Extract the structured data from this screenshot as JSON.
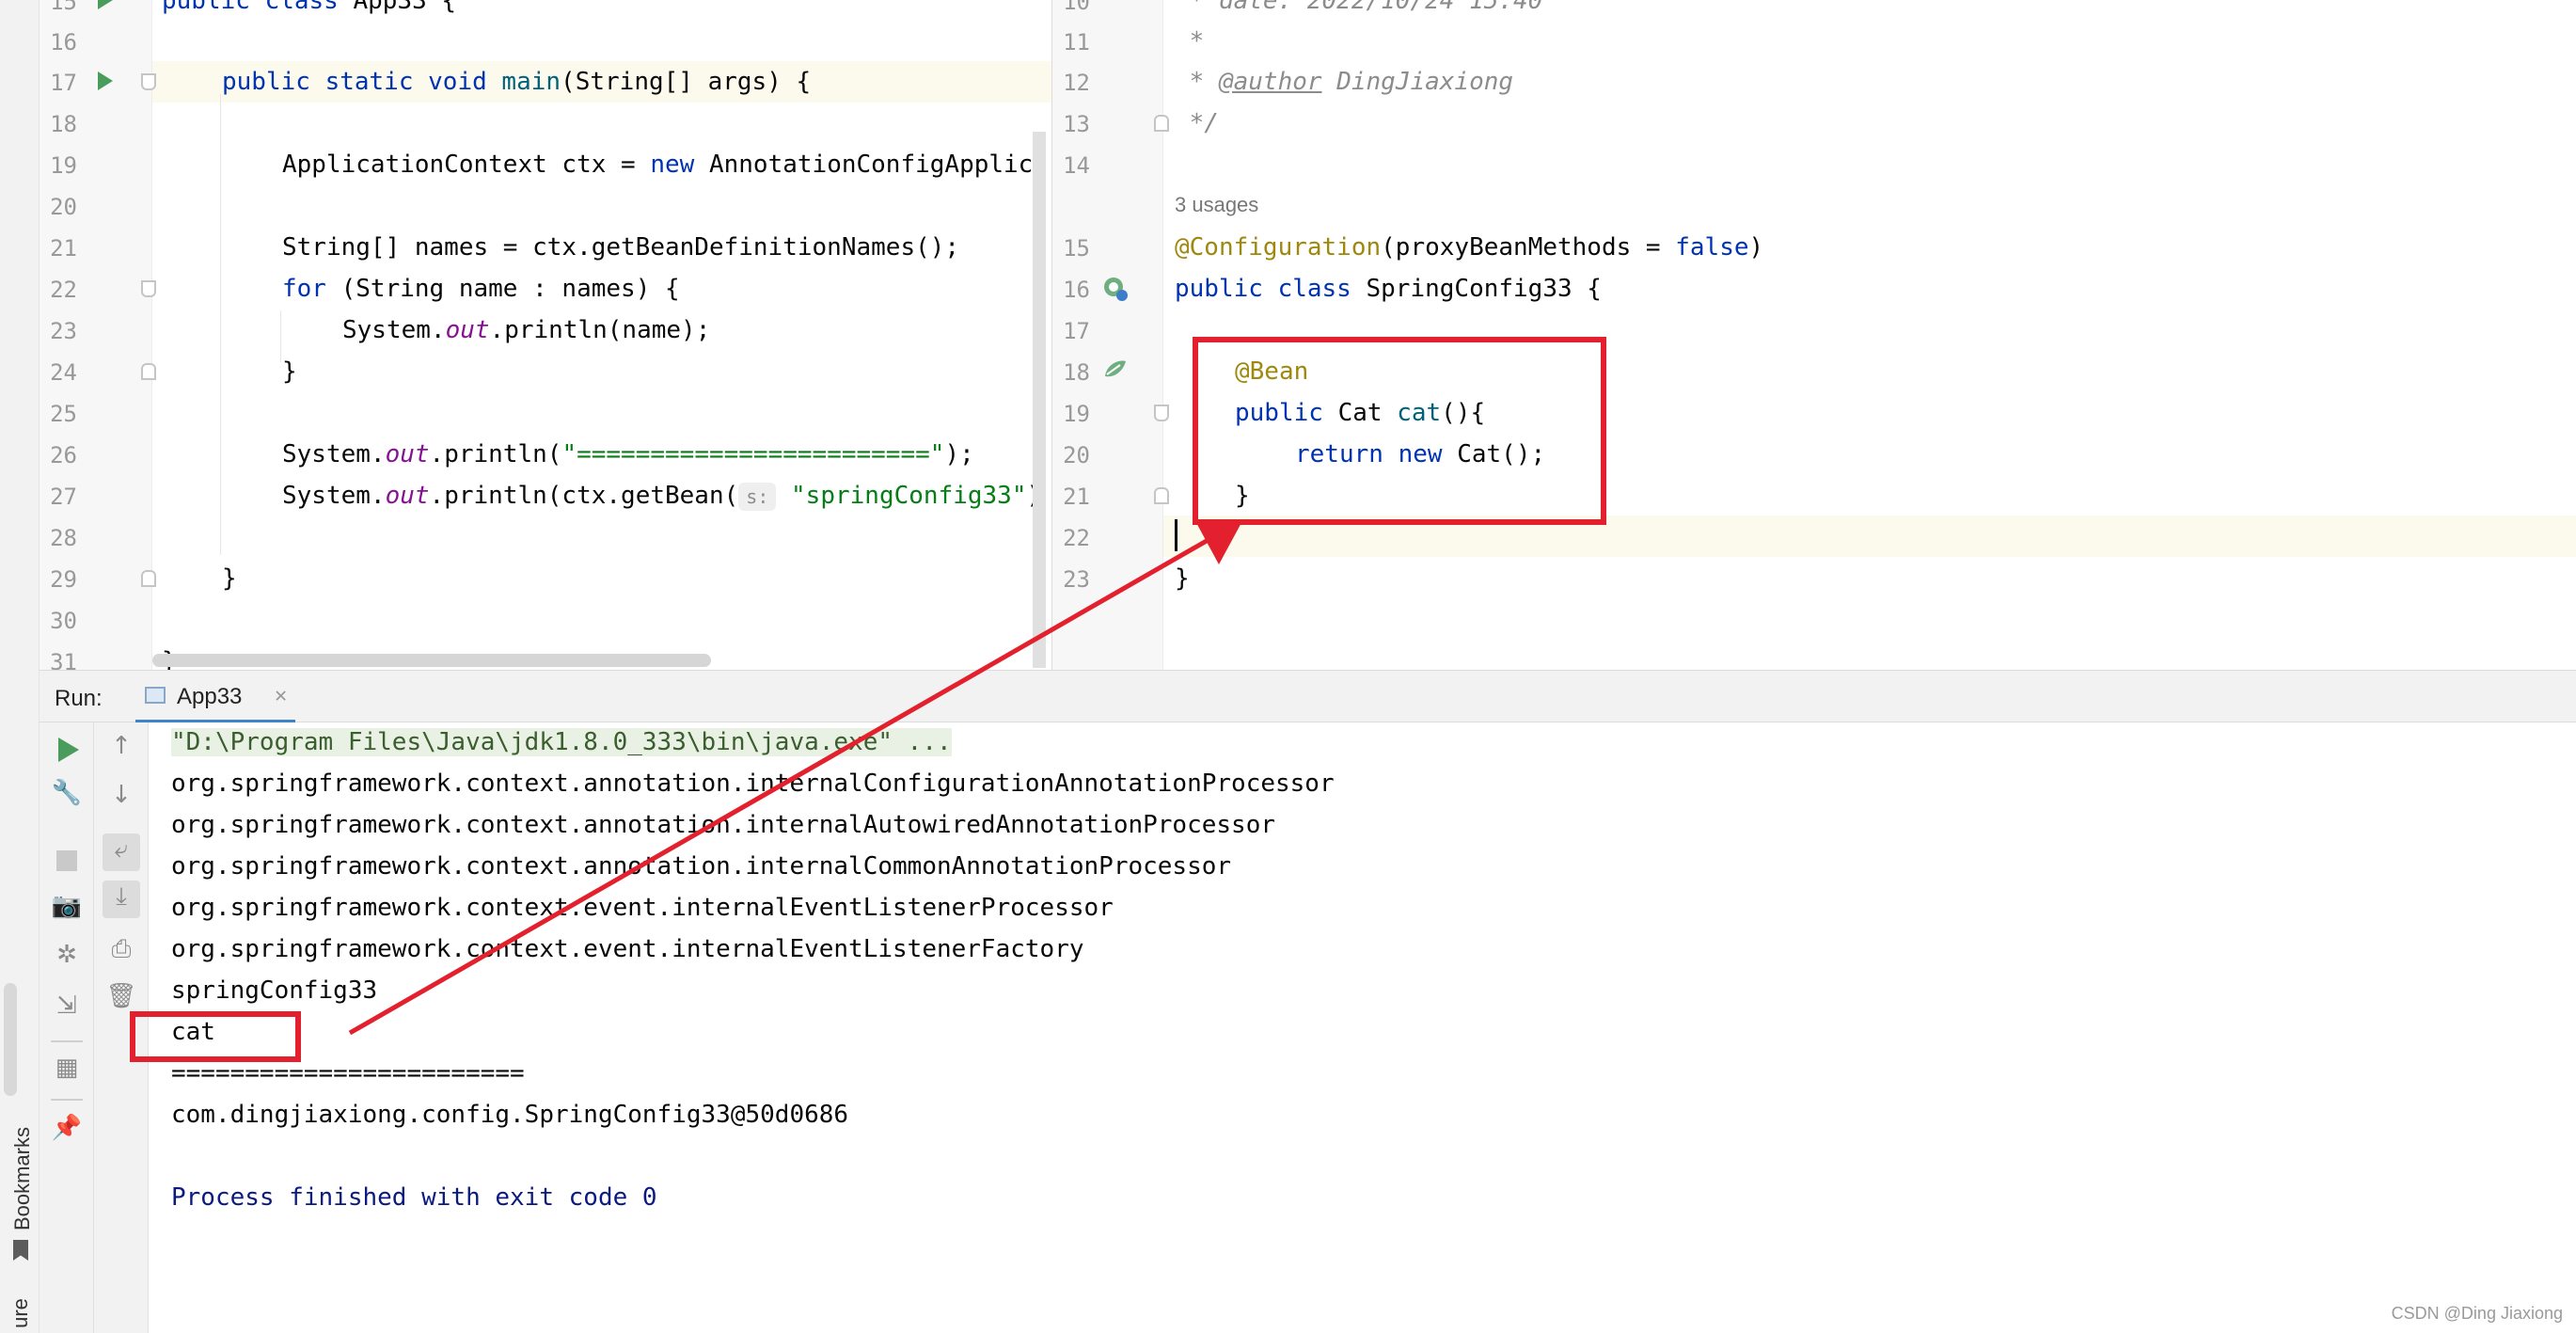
{
  "left_editor": {
    "line_numbers": [
      "15",
      "16",
      "17",
      "18",
      "19",
      "20",
      "21",
      "22",
      "23",
      "24",
      "25",
      "26",
      "27",
      "28",
      "29",
      "30",
      "31"
    ],
    "lines": {
      "l15": "public class App33 {",
      "l17_kw": "public static void ",
      "l17_fn": "main",
      "l17_rest": "(String[] args) {",
      "l19_a": "ApplicationContext ctx = ",
      "l19_kw": "new",
      "l19_b": " AnnotationConfigApplic",
      "l21": "String[] names = ctx.getBeanDefinitionNames();",
      "l22_kw": "for",
      "l22_b": " (String name : names) {",
      "l23_a": "System.",
      "l23_it": "out",
      "l23_b": ".println(name);",
      "l24": "}",
      "l26_a": "System.",
      "l26_it": "out",
      "l26_b": ".println(",
      "l26_st": "\"========================\"",
      "l26_c": ");",
      "l27_a": "System.",
      "l27_it": "out",
      "l27_b": ".println(ctx.getBean(",
      "l27_hint": "s:",
      "l27_st": "\"springConfig33\"",
      "l27_c": ")",
      "l29": "}",
      "l31": "}"
    }
  },
  "right_editor": {
    "line_numbers": [
      "10",
      "11",
      "12",
      "13",
      "14",
      "15",
      "16",
      "17",
      "18",
      "19",
      "20",
      "21",
      "22",
      "23"
    ],
    "lines": {
      "l10": " * date: 2022/10/24 15:40",
      "l11": " *",
      "l12_a": " * ",
      "l12_tag": "@author",
      "l12_b": " DingJiaxiong",
      "l13": " */",
      "usages": "3 usages",
      "l15_an": "@Configuration",
      "l15_b": "(proxyBeanMethods = ",
      "l15_kw": "false",
      "l15_c": ")",
      "l16_kw": "public class ",
      "l16_b": "SpringConfig33 {",
      "l18": "@Bean",
      "l19_kw": "public",
      "l19_b": " Cat ",
      "l19_fn": "cat",
      "l19_c": "(){",
      "l20_kw": "return new",
      "l20_b": " Cat();",
      "l21": "}",
      "l23": "}"
    }
  },
  "run_panel": {
    "label": "Run:",
    "tab": "App33",
    "output": [
      "\"D:\\Program Files\\Java\\jdk1.8.0_333\\bin\\java.exe\" ...",
      "org.springframework.context.annotation.internalConfigurationAnnotationProcessor",
      "org.springframework.context.annotation.internalAutowiredAnnotationProcessor",
      "org.springframework.context.annotation.internalCommonAnnotationProcessor",
      "org.springframework.context.event.internalEventListenerProcessor",
      "org.springframework.context.event.internalEventListenerFactory",
      "springConfig33",
      "cat",
      "========================",
      "com.dingjiaxiong.config.SpringConfig33@50d0686",
      "",
      "Process finished with exit code 0"
    ]
  },
  "sidebar": {
    "bookmarks": "Bookmarks",
    "structure": "ure"
  },
  "watermark": "CSDN @Ding Jiaxiong",
  "colors": {
    "annotation_red": "#e3202d",
    "keyword": "#0033b3",
    "string": "#067d17",
    "run_green": "#4a9c5d"
  },
  "icons": [
    "run-icon",
    "bean-icon",
    "wrench-icon",
    "stop-icon",
    "camera-icon",
    "print-icon",
    "trash-icon",
    "pin-icon",
    "layout-icon"
  ]
}
